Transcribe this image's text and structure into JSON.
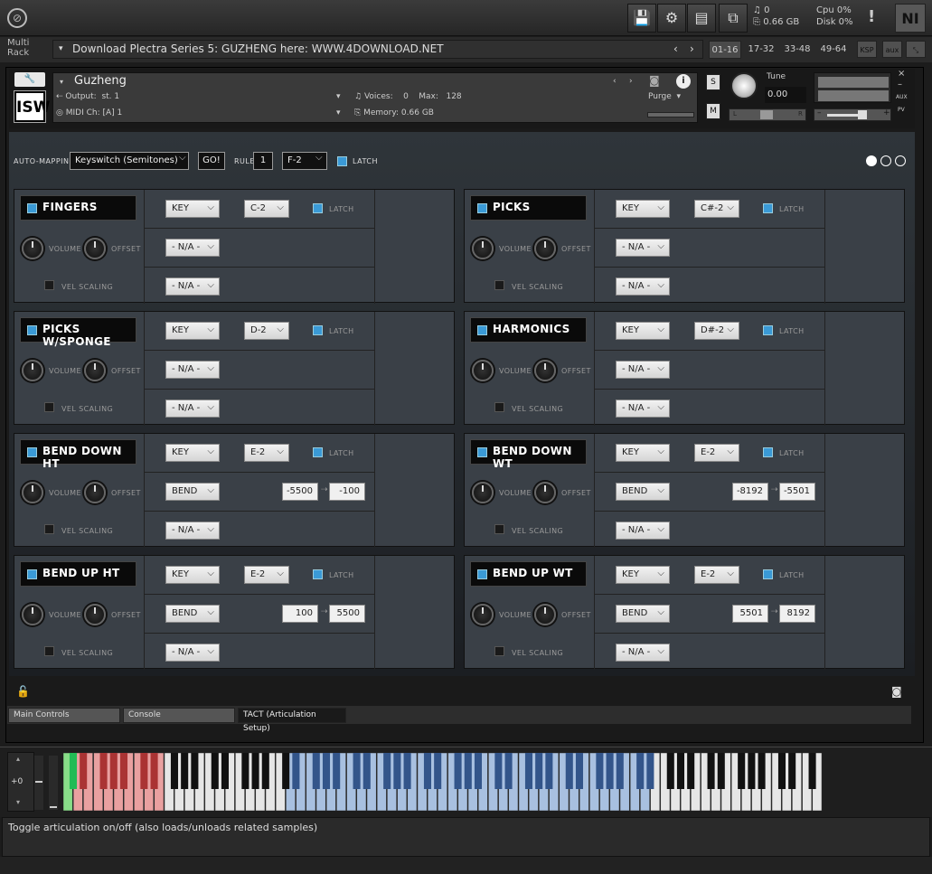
{
  "topbar": {
    "labels": {
      "voices": "0",
      "memory": "0.66 GB",
      "cpu_label": "Cpu",
      "cpu": "0%",
      "disk_label": "Disk",
      "disk": "0%"
    },
    "ni": "NI",
    "alert": "!"
  },
  "rack": {
    "label": "Multi Rack",
    "name": "Download Plectra Series 5: GUZHENG here: WWW.4DOWNLOAD.NET",
    "pages": [
      "01-16",
      "17-32",
      "33-48",
      "49-64"
    ],
    "buttons": [
      "KSP",
      "aux"
    ]
  },
  "instrument": {
    "name": "Guzheng",
    "output_label": "Output:",
    "output": "st. 1",
    "voices_label": "Voices:",
    "voices": "0",
    "max_label": "Max:",
    "max": "128",
    "midi_label": "MIDI Ch:",
    "midi": "[A]  1",
    "memory_label": "Memory:",
    "memory": "0.66 GB",
    "purge": "Purge",
    "tune_label": "Tune",
    "tune": "0.00",
    "s": "S",
    "m": "M",
    "logo": "ISW",
    "aux": "AUX",
    "pv": "PV",
    "l": "L",
    "r": "R",
    "minus": "–",
    "plus": "+"
  },
  "automap": {
    "label": "AUTO-MAPPING",
    "mode": "Keyswitch (Semitones)",
    "go": "GO!",
    "rule_label": "RULE",
    "rule": "1",
    "key": "F-2",
    "latch": "LATCH"
  },
  "common": {
    "volume": "VOLUME",
    "offset": "OFFSET",
    "vel": "VEL SCALING",
    "latch": "LATCH"
  },
  "panels": [
    {
      "name": "FINGERS",
      "on": true,
      "r1": "KEY",
      "key": "C-2",
      "r2": "- N/A -",
      "r3": "- N/A -",
      "from": "",
      "to": ""
    },
    {
      "name": "PICKS",
      "on": true,
      "r1": "KEY",
      "key": "C#-2",
      "r2": "- N/A -",
      "r3": "- N/A -",
      "from": "",
      "to": ""
    },
    {
      "name": "PICKS W/SPONGE",
      "on": true,
      "r1": "KEY",
      "key": "D-2",
      "r2": "- N/A -",
      "r3": "- N/A -",
      "from": "",
      "to": ""
    },
    {
      "name": "HARMONICS",
      "on": true,
      "r1": "KEY",
      "key": "D#-2",
      "r2": "- N/A -",
      "r3": "- N/A -",
      "from": "",
      "to": ""
    },
    {
      "name": "BEND DOWN HT",
      "on": true,
      "r1": "KEY",
      "key": "E-2",
      "r2": "BEND",
      "r3": "- N/A -",
      "from": "-5500",
      "to": "-100"
    },
    {
      "name": "BEND DOWN WT",
      "on": true,
      "r1": "KEY",
      "key": "E-2",
      "r2": "BEND",
      "r3": "- N/A -",
      "from": "-8192",
      "to": "-5501"
    },
    {
      "name": "BEND UP HT",
      "on": true,
      "r1": "KEY",
      "key": "E-2",
      "r2": "BEND",
      "r3": "- N/A -",
      "from": "100",
      "to": "5500"
    },
    {
      "name": "BEND UP WT",
      "on": true,
      "r1": "KEY",
      "key": "E-2",
      "r2": "BEND",
      "r3": "- N/A -",
      "from": "5501",
      "to": "8192"
    }
  ],
  "tabs": [
    "Main Controls",
    "Console",
    "TACT (Articulation Setup)"
  ],
  "keyboard": {
    "octave": "+0"
  },
  "status": "Toggle articulation on/off (also loads/unloads related samples)"
}
